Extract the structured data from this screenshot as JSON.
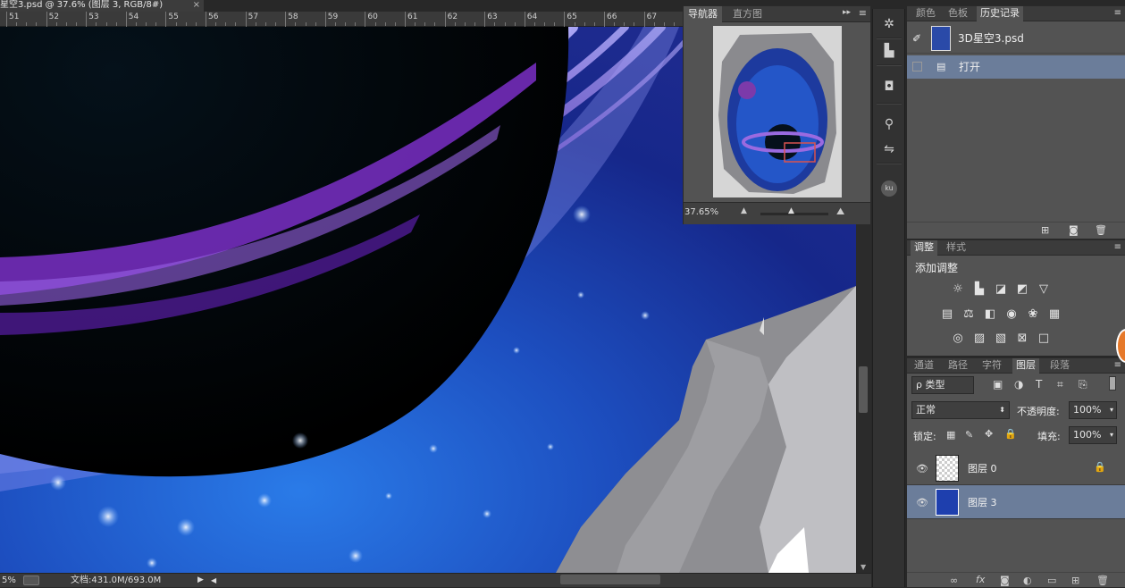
{
  "document": {
    "tab_title": "星空3.psd @ 37.6% (图层 3, RGB/8#)",
    "close_glyph": "×"
  },
  "ruler": {
    "ticks": [
      "51",
      "52",
      "53",
      "54",
      "55",
      "56",
      "57",
      "58",
      "59",
      "60",
      "61",
      "62",
      "63",
      "64",
      "65",
      "66",
      "67"
    ]
  },
  "status": {
    "zoom": "5%",
    "doc_info": "文档:431.0M/693.0M"
  },
  "navigator": {
    "tabs": [
      "导航器",
      "直方图"
    ],
    "zoom": "37.65%",
    "menu_glyph": "▸▸",
    "colors": {
      "view_box": "#d9534f"
    }
  },
  "history_panel": {
    "tabs": [
      "颜色",
      "色板",
      "历史记录"
    ],
    "active_tab": "历史记录",
    "snapshot_name": "3D星空3.psd",
    "steps": [
      "打开"
    ]
  },
  "adjustments_panel": {
    "tabs": [
      "调整",
      "样式"
    ],
    "heading": "添加调整"
  },
  "layers_panel": {
    "tabs": [
      "通道",
      "路径",
      "字符",
      "图层",
      "段落"
    ],
    "active_tab": "图层",
    "filter_kind": "ρ 类型",
    "blend_mode": "正常",
    "opacity_label": "不透明度:",
    "opacity_value": "100%",
    "lock_label": "锁定:",
    "fill_label": "填充:",
    "fill_value": "100%",
    "layers": [
      {
        "name": "图层 0",
        "locked": true,
        "selected": false
      },
      {
        "name": "图层 3",
        "locked": false,
        "selected": true
      }
    ],
    "colors": {
      "selected_row": "#6b7d9a"
    }
  },
  "colors": {
    "app_bg": "#282828",
    "panel_bg": "#535353",
    "accent_orange": "#e6792a"
  }
}
